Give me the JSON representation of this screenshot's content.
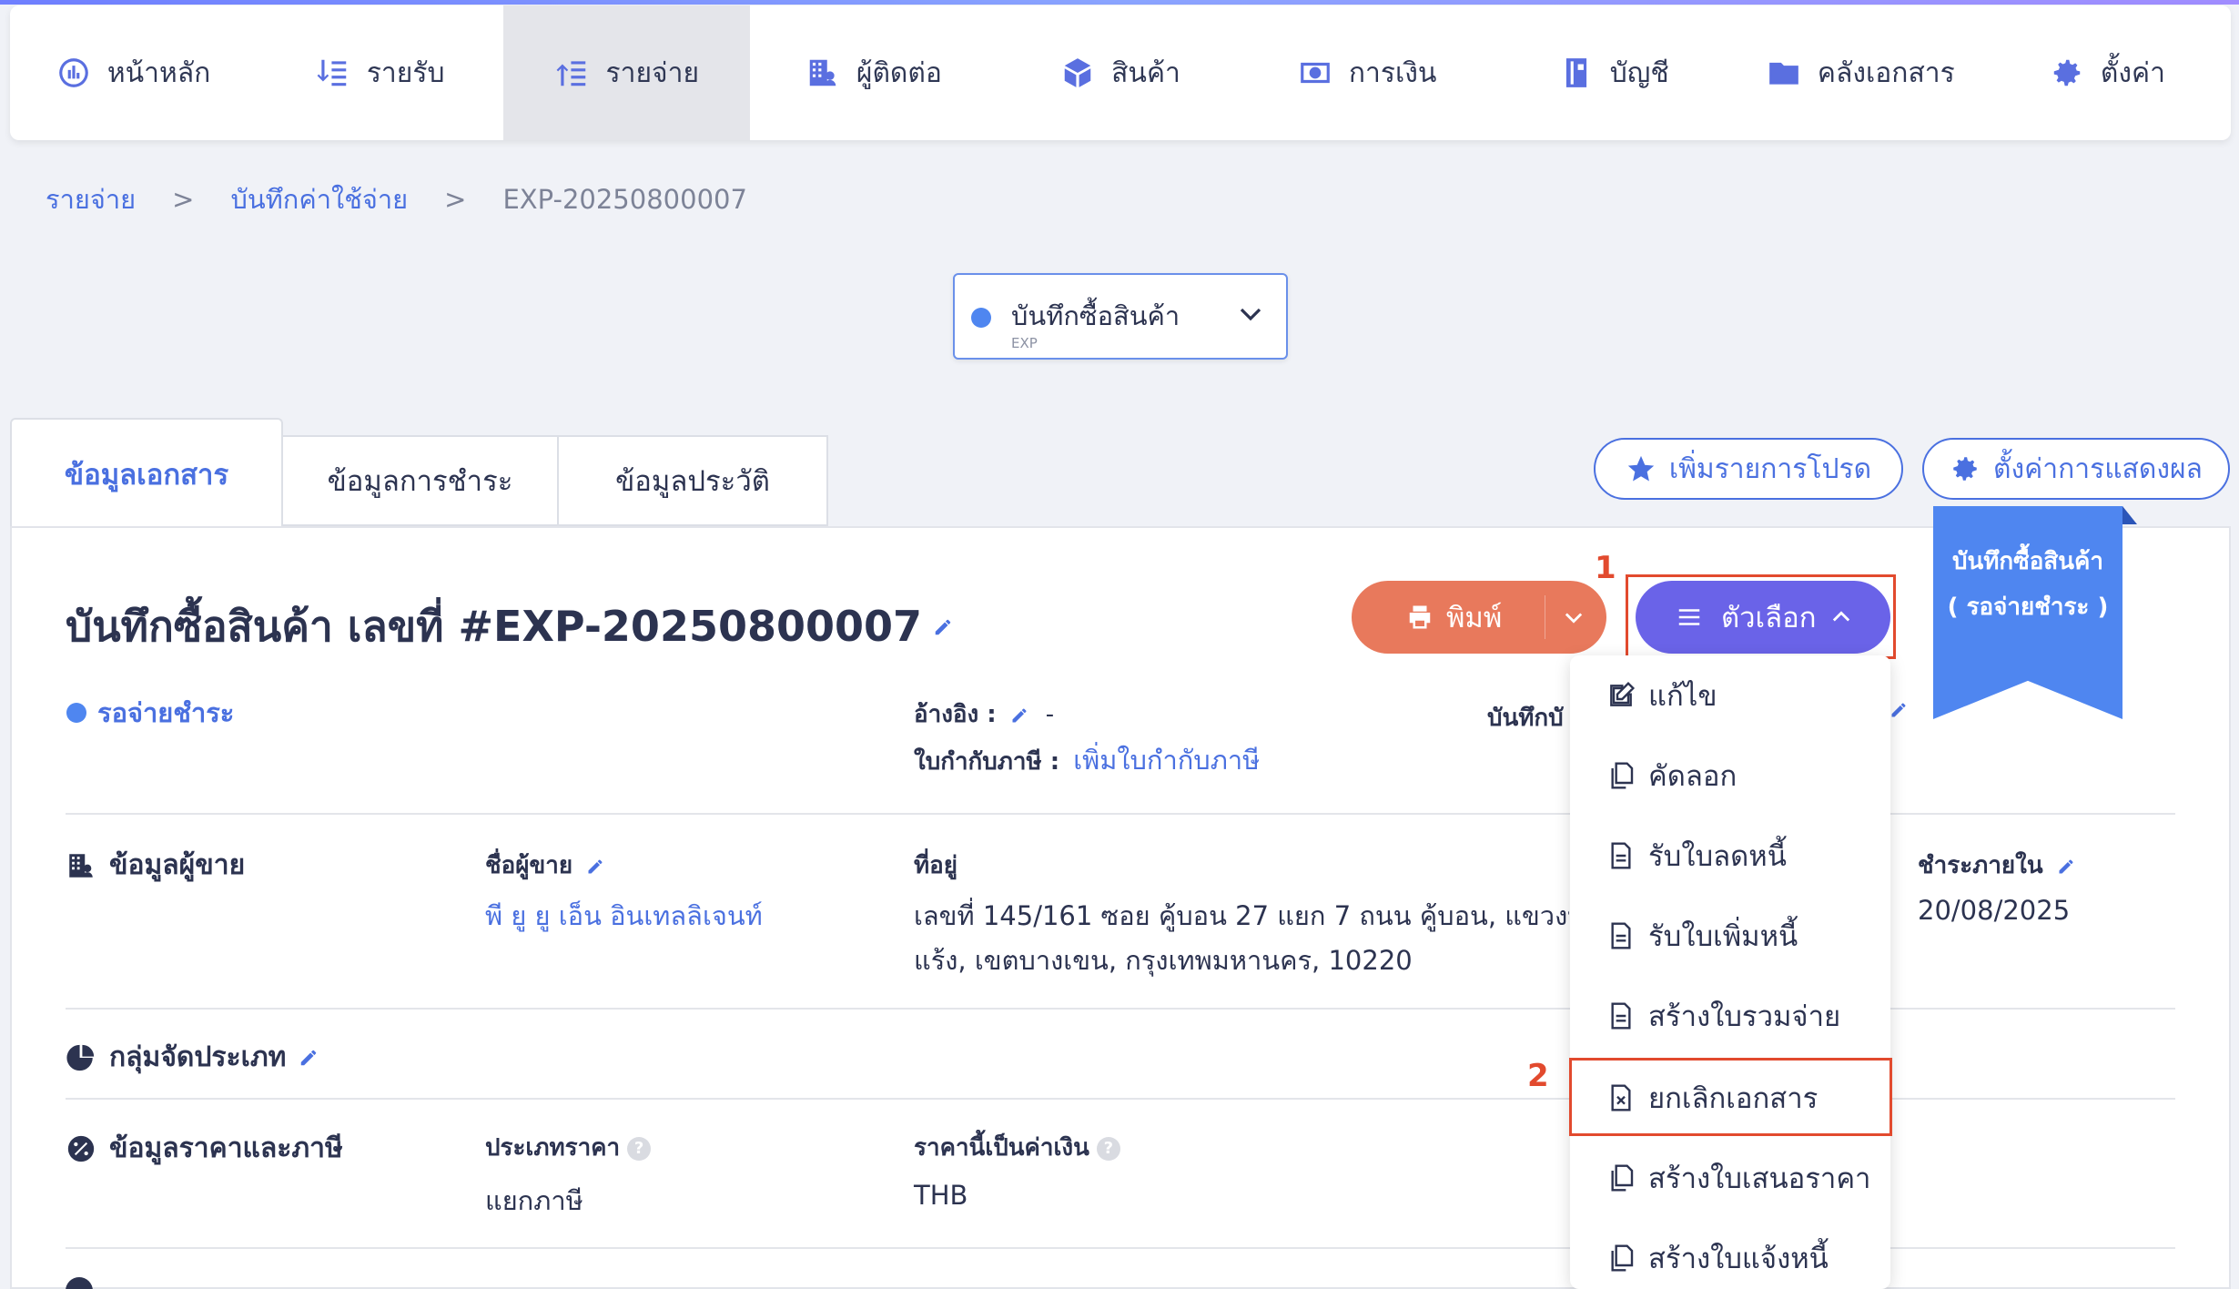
{
  "nav": {
    "items": [
      {
        "label": "หน้าหลัก",
        "icon": "dashboard-icon"
      },
      {
        "label": "รายรับ",
        "icon": "income-icon"
      },
      {
        "label": "รายจ่าย",
        "icon": "expense-icon"
      },
      {
        "label": "ผู้ติดต่อ",
        "icon": "contacts-icon"
      },
      {
        "label": "สินค้า",
        "icon": "product-box-icon"
      },
      {
        "label": "การเงิน",
        "icon": "money-icon"
      },
      {
        "label": "บัญชี",
        "icon": "ledger-book-icon"
      },
      {
        "label": "คลังเอกสาร",
        "icon": "folder-icon"
      },
      {
        "label": "ตั้งค่า",
        "icon": "gear-icon"
      }
    ],
    "active_index": 2
  },
  "breadcrumb": {
    "level1": "รายจ่าย",
    "sep": ">",
    "level2": "บันทึกค่าใช้จ่าย",
    "current": "EXP-20250800007"
  },
  "doc_type": {
    "label": "บันทึกซื้อสินค้า",
    "code": "EXP"
  },
  "tabs": {
    "doc_info": "ข้อมูลเอกสาร",
    "payment": "ข้อมูลการชำระ",
    "history": "ข้อมูลประวัติ"
  },
  "actions": {
    "favorite": "เพิ่มรายการโปรด",
    "display_settings": "ตั้งค่าการแสดงผล"
  },
  "ribbon": {
    "line1": "บันทึกซื้อสินค้า",
    "line2": "( รอจ่ายชำระ )"
  },
  "document": {
    "title": "บันทึกซื้อสินค้า เลขที่ #EXP-20250800007",
    "status": "รอจ่ายชำระ",
    "reference_label": "อ้างอิง :",
    "reference_value": "-",
    "tax_invoice_label": "ใบกำกับภาษี :",
    "tax_invoice_link": "เพิ่มใบกำกับภาษี",
    "record_label_partial": "บันทึกบั"
  },
  "buttons": {
    "print": "พิมพ์",
    "options": "ตัวเลือก"
  },
  "annotations": {
    "step1": "1",
    "step2": "2"
  },
  "vendor": {
    "section": "ข้อมูลผู้ขาย",
    "name_label": "ชื่อผู้ขาย",
    "name_value": "พี ยู ยู เอ็น อินเทลลิเจนท์",
    "address_label": "ที่อยู่",
    "address_line1": "เลขที่ 145/161 ซอย คู้บอน 27 แยก 7 ถนน คู้บอน, แขวงท่",
    "address_line2": "แร้ง, เขตบางเขน, กรุงเทพมหานคร, 10220",
    "due_label": "ชำระภายใน",
    "due_value": "20/08/2025"
  },
  "category": {
    "section": "กลุ่มจัดประเภท"
  },
  "pricing": {
    "section": "ข้อมูลราคาและภาษี",
    "price_type_label": "ประเภทราคา",
    "price_type_value": "แยกภาษี",
    "currency_label": "ราคานี้เป็นค่าเงิน",
    "currency_value": "THB"
  },
  "menu": {
    "items": [
      {
        "label": "แก้ไข",
        "icon": "edit-icon"
      },
      {
        "label": "คัดลอก",
        "icon": "copy-icon"
      },
      {
        "label": "รับใบลดหนี้",
        "icon": "document-icon"
      },
      {
        "label": "รับใบเพิ่มหนี้",
        "icon": "document-icon"
      },
      {
        "label": "สร้างใบรวมจ่าย",
        "icon": "document-icon"
      },
      {
        "label": "ยกเลิกเอกสาร",
        "icon": "cancel-document-icon"
      },
      {
        "label": "สร้างใบเสนอราคา",
        "icon": "copy-icon"
      },
      {
        "label": "สร้างใบแจ้งหนี้",
        "icon": "copy-icon"
      }
    ]
  },
  "colors": {
    "accent": "#4a70e0",
    "print": "#e8795c",
    "options": "#6a63e8",
    "highlight": "#e24a2e",
    "ribbon": "#4f86f0"
  }
}
